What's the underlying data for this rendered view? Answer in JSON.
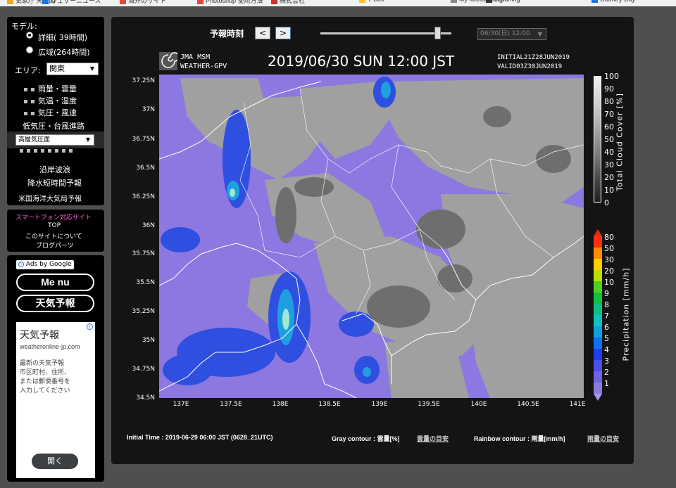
{
  "bookmarks": [
    "気象庁 天気図",
    "ウェザーニュース",
    "海外のサイト",
    "Photoshop 使用方法",
    "株式会社",
    "Y-Box",
    "My Management",
    "Lightning",
    "Country Day"
  ],
  "sidebar": {
    "model_label": "モデル:",
    "model_options": [
      {
        "label": "詳細(  39時間)",
        "selected": true
      },
      {
        "label": "広域(264時間)",
        "selected": false
      }
    ],
    "area_label": "エリア:",
    "area_value": "関東",
    "layers": [
      "雨量・雲量",
      "気温・湿度",
      "気圧・風速"
    ],
    "typhoon": "低気圧・台風進路",
    "altitude_select": "高層気圧面",
    "links": [
      "沿岸波浪",
      "降水短時間予報",
      "米国海洋大気局予報"
    ],
    "smartphone": "スマートフォン対応サイト",
    "top": "TOP",
    "about": "このサイトについて",
    "blog": "ブログパーツ",
    "ads_by": "Ads by Google",
    "menu_btn": "Me nu",
    "weather_btn": "天気予報",
    "ad_title": "天気予報",
    "ad_domain": "weatheronline-jp.com",
    "ad_body": [
      "最新の天気予報",
      "市区町村、住所、",
      "または郵便番号を",
      "入力してください"
    ],
    "ad_button": "開く"
  },
  "main": {
    "time_label": "予報時刻",
    "prev": "<",
    "next": ">",
    "slider_value": 0.9,
    "date_select": "06/30(日) 12:00",
    "logo_l1": "JMA MSM",
    "logo_l2": "WEATHER-GPV",
    "map_title": "2019/06/30 SUN 12:00 JST",
    "initial": "INITIAL21Z28JUN2019",
    "valid": "VALID03Z30JUN2019",
    "lat_labels": [
      "37.25N",
      "37N",
      "36.75N",
      "36.5N",
      "36.25N",
      "36N",
      "35.75N",
      "35.5N",
      "35.25N",
      "35N",
      "34.75N",
      "34.5N"
    ],
    "lon_labels": [
      "137E",
      "137.5E",
      "138E",
      "138.5E",
      "139E",
      "139.5E",
      "140E",
      "140.5E",
      "141E"
    ],
    "cloud_ticks": [
      "100",
      "90",
      "80",
      "70",
      "60",
      "50",
      "40",
      "30",
      "20",
      "10",
      "0"
    ],
    "cloud_title": "Total Cloud Cover [%]",
    "precip_ticks": [
      "80",
      "50",
      "30",
      "20",
      "10",
      "9",
      "8",
      "7",
      "6",
      "5",
      "4",
      "3",
      "2",
      "1"
    ],
    "precip_title": "Precipitation [mm/h]",
    "footer_initial": "Initial Time : 2019-06-29 06:00 JST (0628_21UTC)",
    "footer_gray": "Gray contour : 雲量[%]",
    "footer_gray_link": "雲量の目安",
    "footer_rainbow": "Rainbow contour : 雨量[mm/h]",
    "footer_rainbow_link": "雨量の目安"
  },
  "colors": {
    "precip_purple": "#8c78e0",
    "accent_pink": "#ff66cc"
  }
}
